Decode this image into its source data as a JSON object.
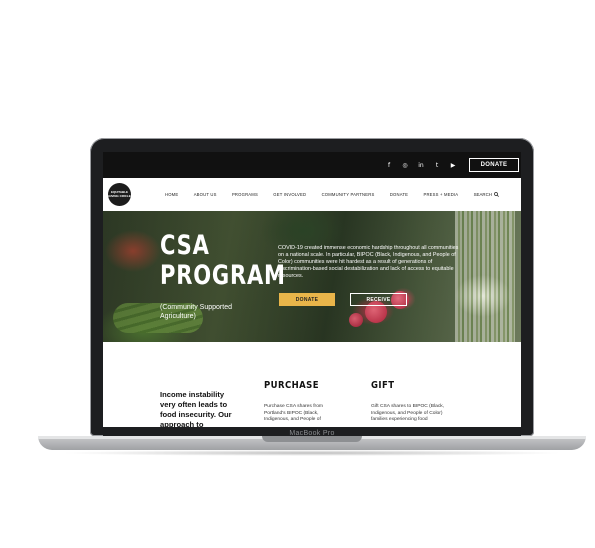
{
  "topbar": {
    "social_icons": [
      "facebook-icon",
      "instagram-icon",
      "linkedin-icon",
      "twitter-icon",
      "youtube-icon"
    ],
    "social_glyphs": [
      "f",
      "◎",
      "in",
      "t",
      "▶"
    ],
    "donate_label": "DONATE"
  },
  "nav": {
    "logo_text": "EQUITABLE GIVING CIRCLE",
    "items": [
      "HOME",
      "ABOUT US",
      "PROGRAMS",
      "GET INVOLVED",
      "COMMUNITY PARTNERS",
      "DONATE",
      "PRESS + MEDIA"
    ],
    "search_label": "SEARCH"
  },
  "hero": {
    "title_line1": "CSA",
    "title_line2": "PROGRAM",
    "subtitle": "(Community Supported Agriculture)",
    "text": "COVID-19 created immense economic hardship throughout all communities on a national scale. In particular,  BIPOC (Black, Indigenous, and People of Color) communities were hit hardest as a result of generations of discrimination-based social destabilization and lack of access to equitable resources.",
    "donate_button": "DONATE",
    "receive_button": "RECEIVE"
  },
  "content": {
    "intro": "Income instability very often leads to food insecurity. Our approach to",
    "purchase_heading": "PURCHASE",
    "purchase_text": "Purchase CSA shares from Portland's BIPOC (Black, Indigenous, and People of",
    "gift_heading": "GIFT",
    "gift_text": "Gift CSA shares to BIPOC (Black, Indigenous, and People of Color) families experiencing food"
  },
  "device": {
    "brand": "MacBook Pro"
  },
  "colors": {
    "topbar": "#111111",
    "donate_button": "#e9b54a",
    "laptop_frame": "#1d1e20"
  }
}
